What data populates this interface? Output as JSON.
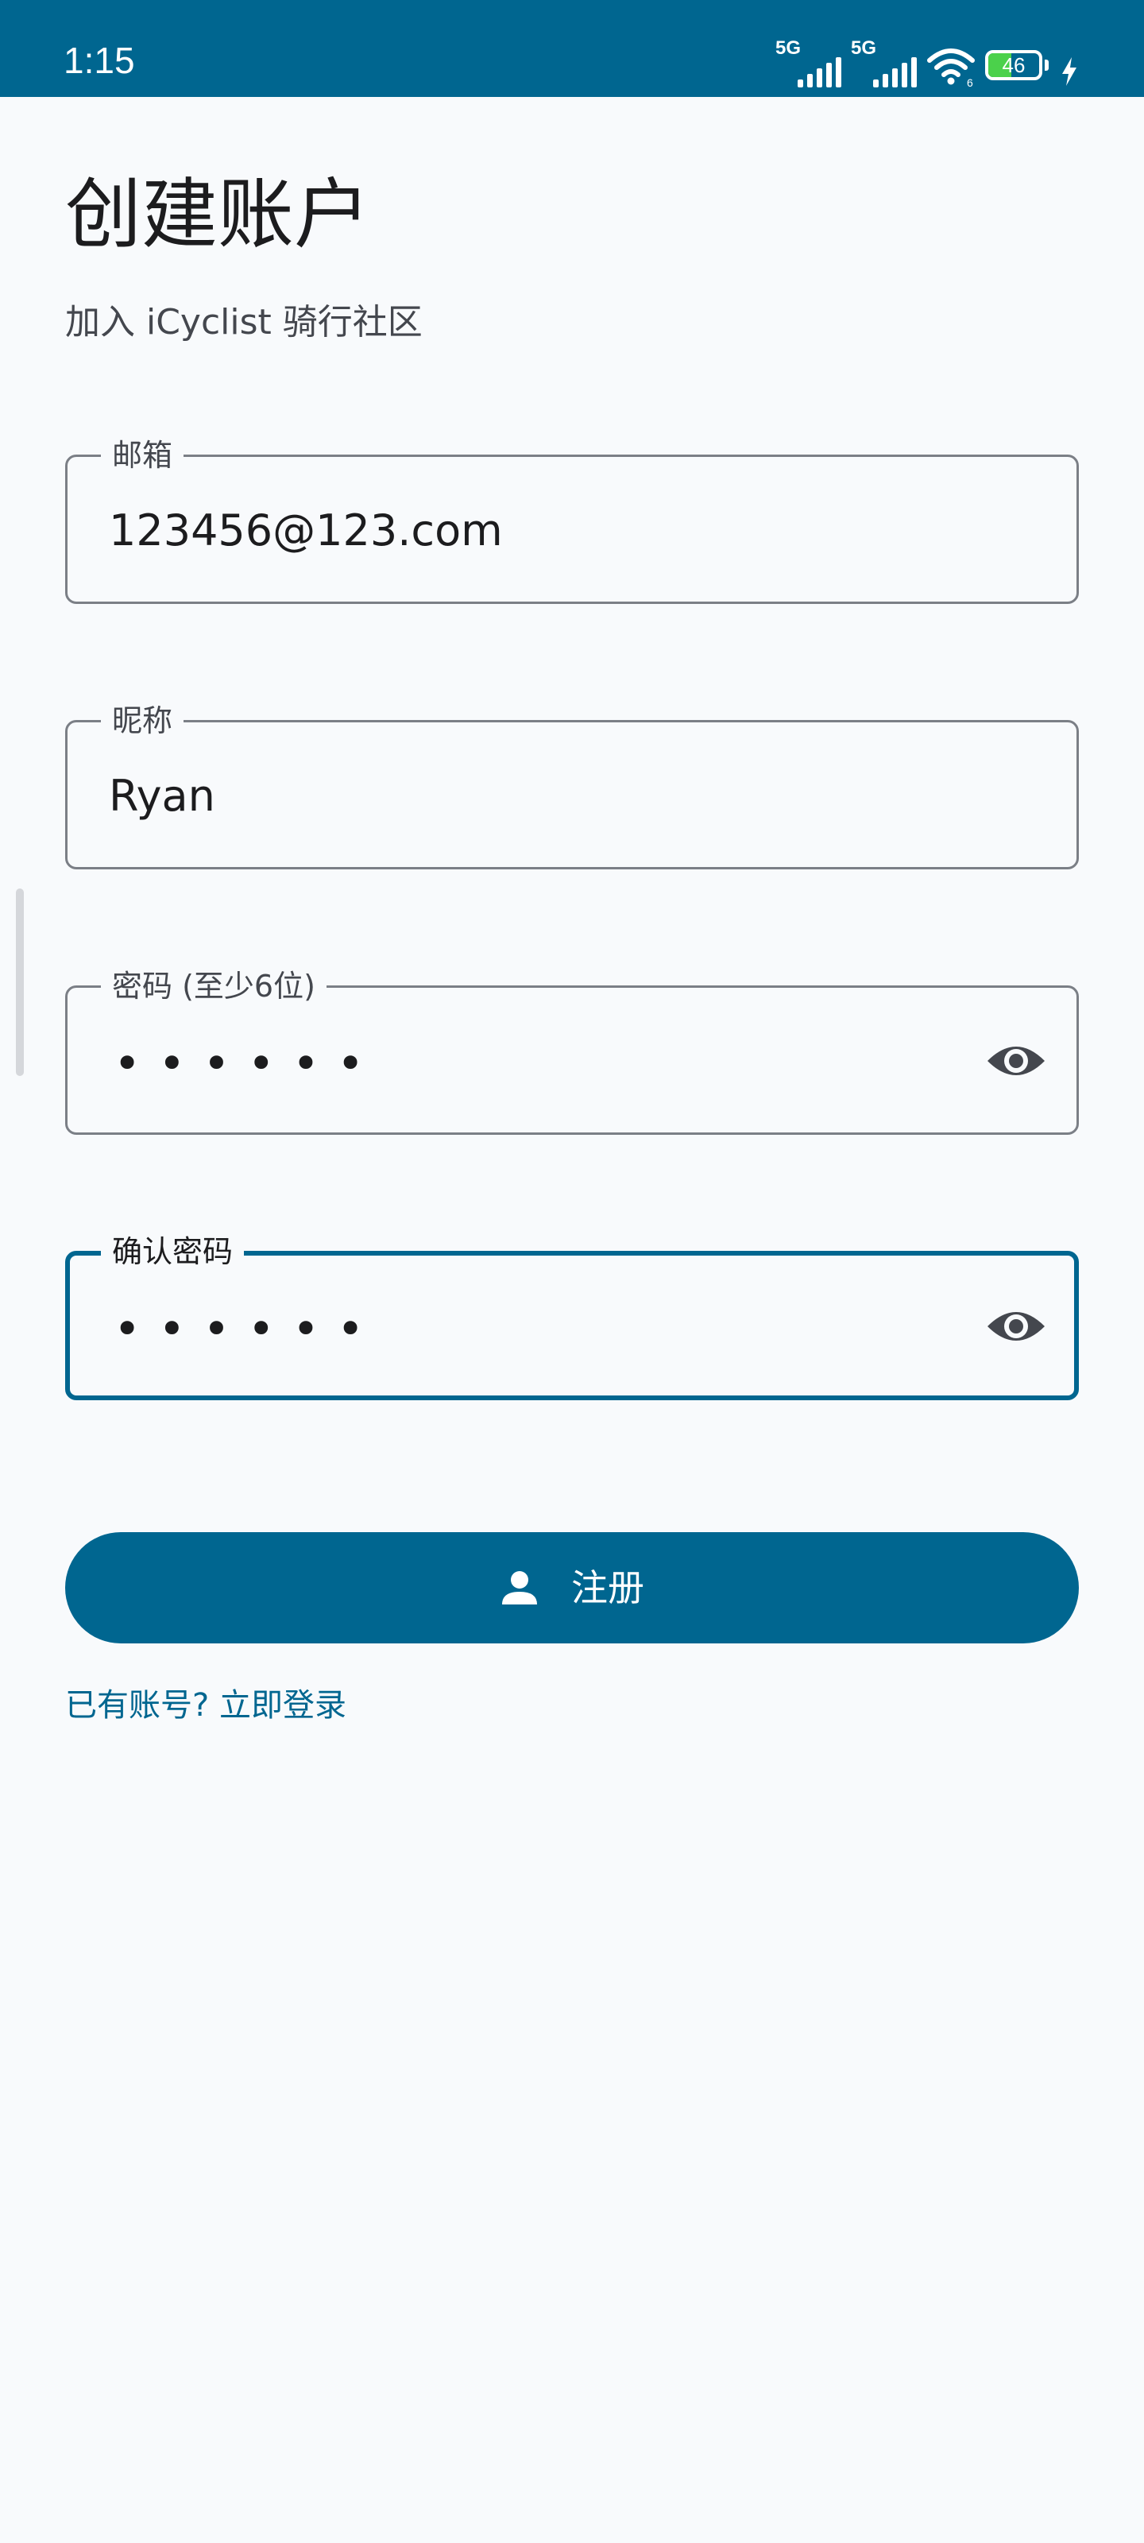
{
  "status_bar": {
    "time": "1:15",
    "signal_1": {
      "label": "5G",
      "icon": "cellular-signal-icon"
    },
    "signal_2": {
      "label": "5G",
      "icon": "cellular-signal-icon"
    },
    "wifi": {
      "label": "6",
      "icon": "wifi-icon"
    },
    "battery": {
      "percent_text": "46",
      "level": 0.46,
      "charging": true,
      "icon": "battery-icon"
    },
    "background_color": "#006690"
  },
  "header": {
    "title": "创建账户",
    "subtitle": "加入 iCyclist 骑行社区"
  },
  "form": {
    "email": {
      "label": "邮箱",
      "value": "123456@123.com"
    },
    "nickname": {
      "label": "昵称",
      "value": "Ryan"
    },
    "password": {
      "label": "密码 (至少6位)",
      "masked_value": "••••••",
      "toggle_icon": "eye-icon"
    },
    "confirm_password": {
      "label": "确认密码",
      "masked_value": "••••••",
      "toggle_icon": "eye-icon",
      "focused": true
    }
  },
  "actions": {
    "register_label": "注册",
    "register_icon": "person-icon",
    "login_link": "已有账号? 立即登录"
  },
  "colors": {
    "primary": "#006690",
    "background": "#f8fafc",
    "outline": "#7b7f86",
    "text": "#1c1c1e",
    "secondary_text": "#44474e",
    "battery_fill": "#4bd14b"
  }
}
